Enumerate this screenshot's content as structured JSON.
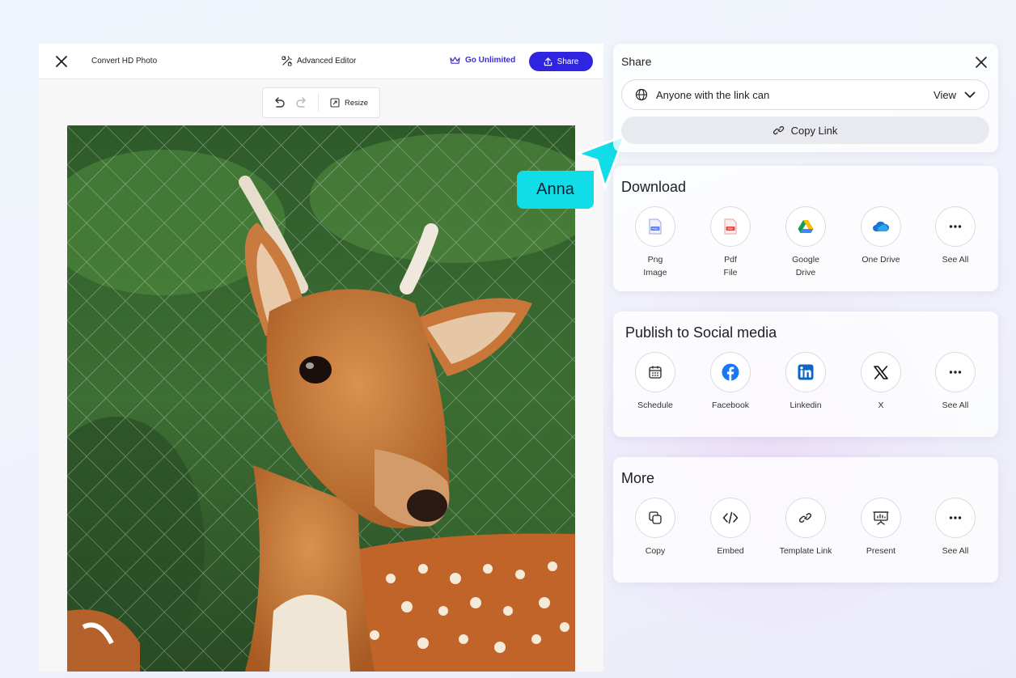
{
  "editor": {
    "title": "Convert HD Photo",
    "advanced_editor": "Advanced Editor",
    "go_unlimited": "Go Unlimited",
    "share": "Share",
    "toolbar": {
      "resize": "Resize"
    }
  },
  "collaborator": {
    "name": "Anna",
    "color": "#10dde8"
  },
  "share_panel": {
    "title": "Share",
    "link_access_label": "Anyone with the link can",
    "link_access_value": "View",
    "copy_link": "Copy Link"
  },
  "download": {
    "title": "Download",
    "items": [
      {
        "label": "Png\nImage",
        "icon": "png-file-icon"
      },
      {
        "label": "Pdf\nFile",
        "icon": "pdf-file-icon"
      },
      {
        "label": "Google\nDrive",
        "icon": "google-drive-icon"
      },
      {
        "label": "One Drive",
        "icon": "onedrive-icon"
      },
      {
        "label": "See All",
        "icon": "more-icon"
      }
    ]
  },
  "social": {
    "title": "Publish to Social media",
    "items": [
      {
        "label": "Schedule",
        "icon": "calendar-icon"
      },
      {
        "label": "Facebook",
        "icon": "facebook-icon"
      },
      {
        "label": "Linkedin",
        "icon": "linkedin-icon"
      },
      {
        "label": "X",
        "icon": "x-icon"
      },
      {
        "label": "See All",
        "icon": "more-icon"
      }
    ]
  },
  "more": {
    "title": "More",
    "items": [
      {
        "label": "Copy",
        "icon": "copy-icon"
      },
      {
        "label": "Embed",
        "icon": "embed-code-icon"
      },
      {
        "label": "Template Link",
        "icon": "link-icon"
      },
      {
        "label": "Present",
        "icon": "presentation-icon"
      },
      {
        "label": "See All",
        "icon": "more-icon"
      }
    ]
  },
  "colors": {
    "accent": "#2f24e0",
    "brand_text": "#3b2ed6",
    "cursor": "#10dde8"
  }
}
